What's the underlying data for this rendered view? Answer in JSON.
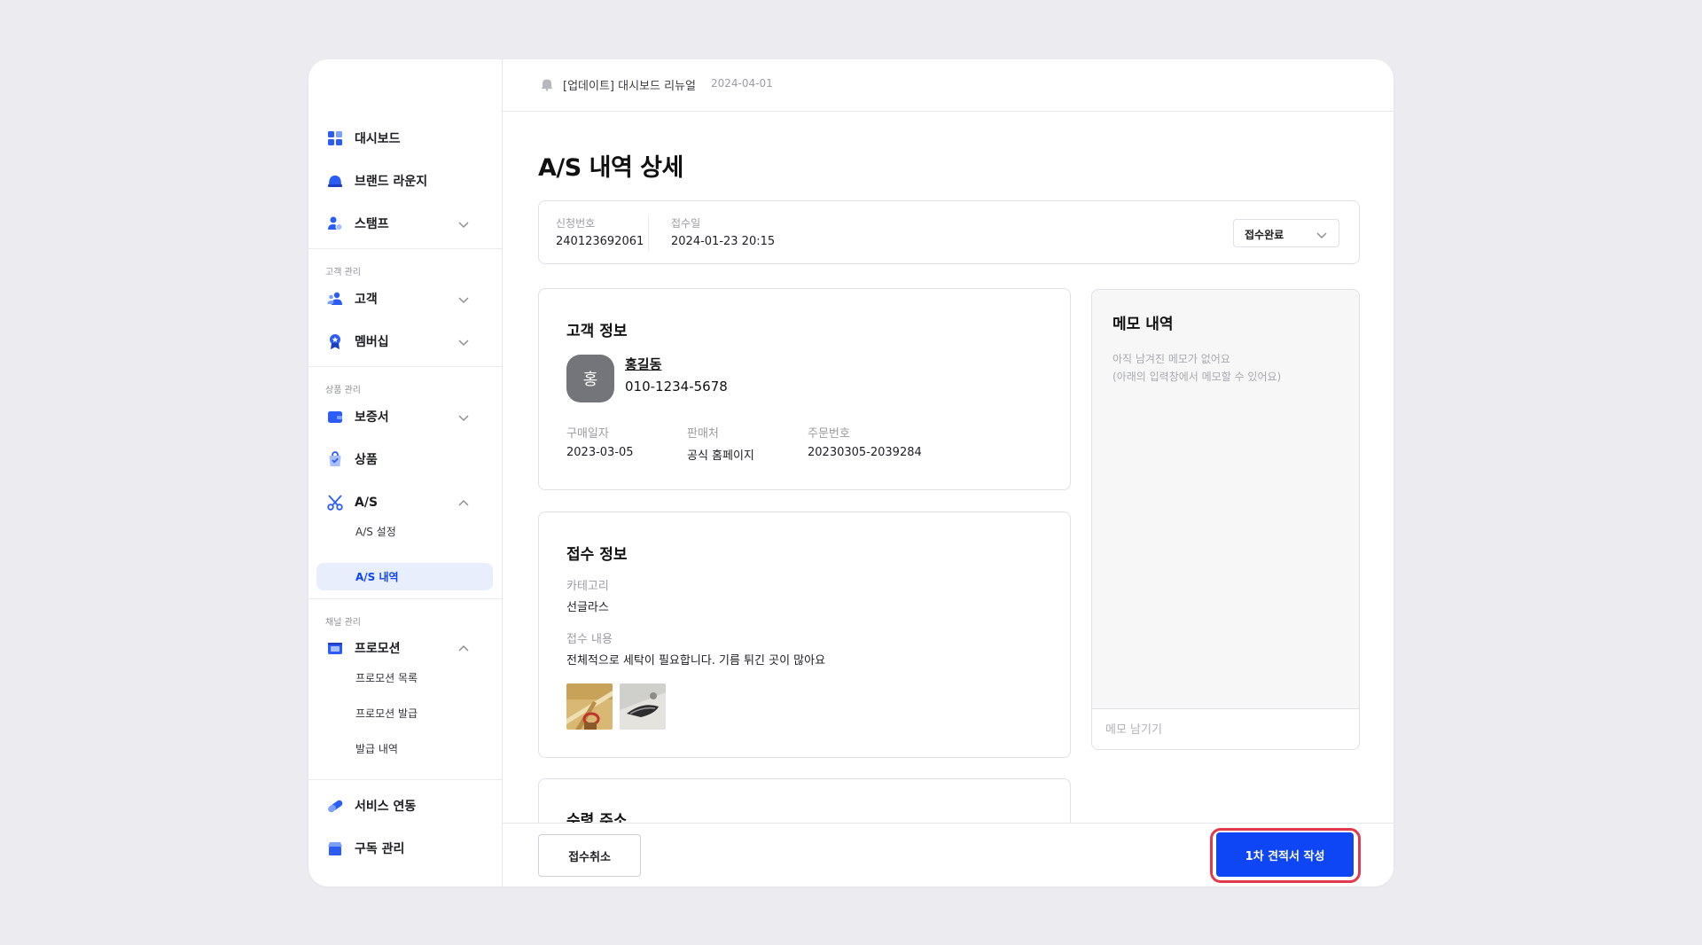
{
  "sidebar": {
    "items": [
      {
        "label": "대시보드"
      },
      {
        "label": "브랜드 라운지"
      },
      {
        "label": "스탬프"
      },
      {
        "label": "고객"
      },
      {
        "label": "멤버십"
      },
      {
        "label": "보증서"
      },
      {
        "label": "상품"
      },
      {
        "label": "A/S"
      },
      {
        "label": "프로모션"
      },
      {
        "label": "서비스 연동"
      },
      {
        "label": "구독 관리"
      }
    ],
    "sections": [
      "고객 관리",
      "상품 관리",
      "채널 관리"
    ],
    "sub_items": {
      "as_settings": "A/S 설정",
      "as_history": "A/S 내역",
      "promo_list": "프로모션 목록",
      "promo_issue": "프로모션 발급",
      "issue_history": "발급 내역"
    }
  },
  "topbar": {
    "notice_title": "[업데이트] 대시보드 리뉴얼",
    "notice_date": "2024-04-01"
  },
  "page": {
    "title": "A/S 내역 상세"
  },
  "summary": {
    "request_no_label": "신청번호",
    "request_no": "240123692061",
    "received_label": "접수일",
    "received_at": "2024-01-23 20:15",
    "status": "접수완료"
  },
  "customer": {
    "title": "고객 정보",
    "avatar_initial": "홍",
    "name": "홍길동",
    "phone": "010-1234-5678",
    "purchase_date_label": "구매일자",
    "purchase_date": "2023-03-05",
    "seller_label": "판매처",
    "seller": "공식 홈페이지",
    "order_no_label": "주문번호",
    "order_no": "20230305-2039284"
  },
  "reception": {
    "title": "접수 정보",
    "category_label": "카테고리",
    "category": "선글라스",
    "content_label": "접수 내용",
    "content": "전체적으로 세탁이 필요합니다. 기름 튀긴 곳이 많아요"
  },
  "address": {
    "title": "수령 주소"
  },
  "memo": {
    "title": "메모 내역",
    "empty_line1": "아직 남겨진 메모가 없어요",
    "empty_line2": "(아래의 입력창에서 메모할 수 있어요)",
    "placeholder": "메모 남기기"
  },
  "actions": {
    "cancel": "접수취소",
    "primary": "1차 견적서 작성"
  },
  "colors": {
    "accent": "#0e45f5",
    "highlight": "#e23a4d",
    "active_bg": "#e9eefc"
  }
}
